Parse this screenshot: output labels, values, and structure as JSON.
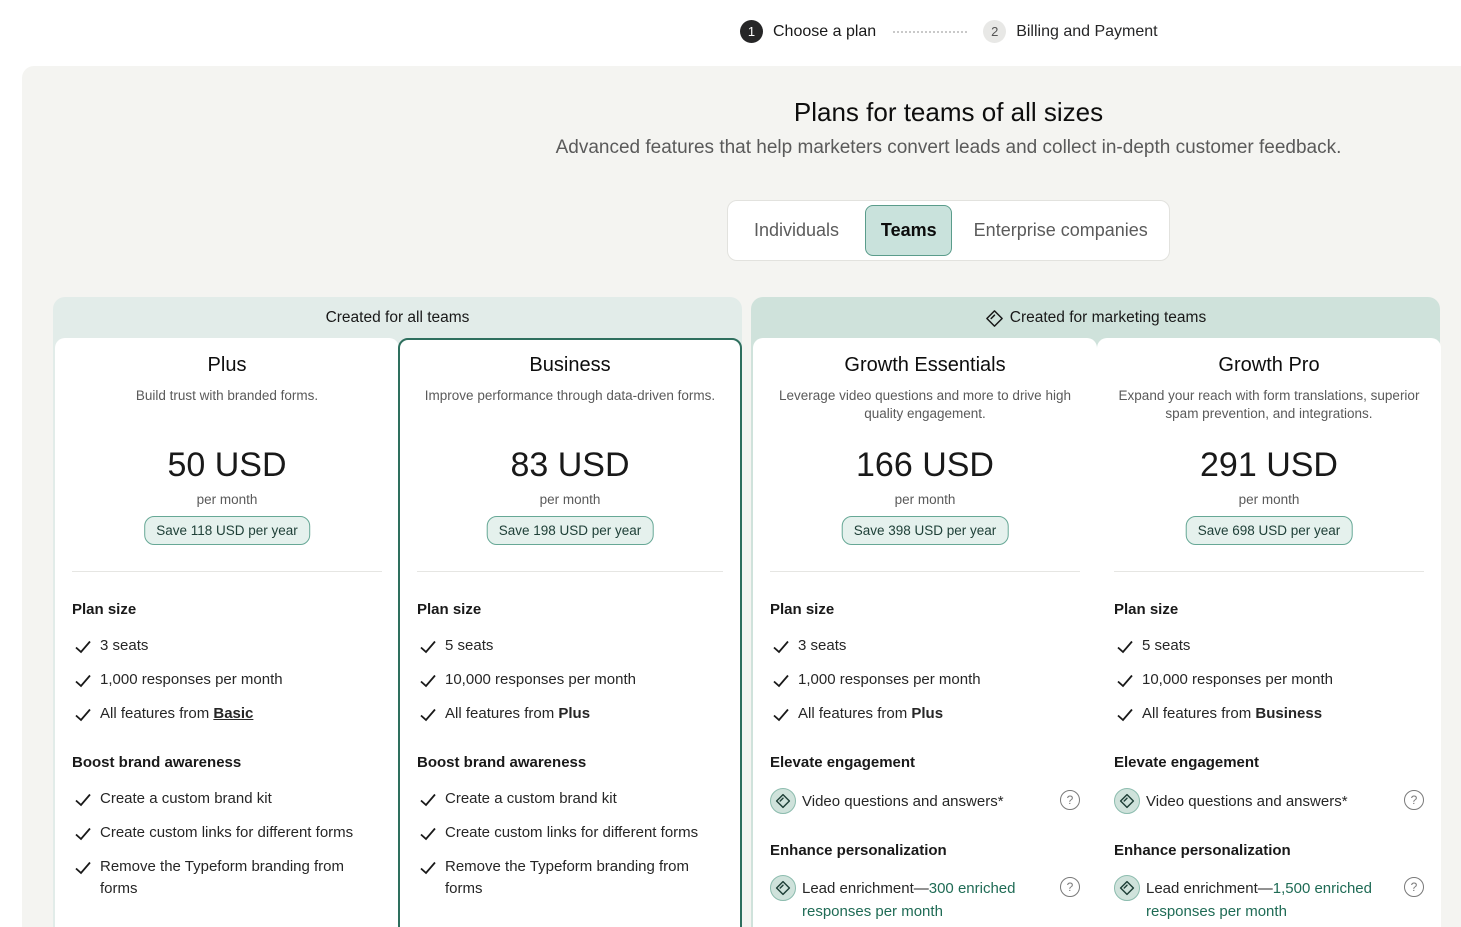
{
  "stepper": {
    "steps": [
      {
        "num": "1",
        "label": "Choose a plan"
      },
      {
        "num": "2",
        "label": "Billing and Payment"
      }
    ]
  },
  "header": {
    "title": "Plans for teams of all sizes",
    "subtitle": "Advanced features that help marketers convert leads and collect in-depth customer feedback."
  },
  "segmented": {
    "options": [
      "Individuals",
      "Teams",
      "Enterprise companies"
    ],
    "selected": "Teams"
  },
  "groups": {
    "all": "Created for all teams",
    "marketing": "Created for marketing teams"
  },
  "plans": [
    {
      "name": "Plus",
      "desc": "Build trust with branded forms.",
      "price": "50 USD",
      "per": "per month",
      "save": "Save 118 USD per year",
      "plan_size_title": "Plan size",
      "seats": "3 seats",
      "responses": "1,000 responses per month",
      "features_from_prefix": "All features from ",
      "features_from": "Basic",
      "section2_title": "Boost brand awareness",
      "f1": "Create a custom brand kit",
      "f2": "Create custom links for different forms",
      "f3": "Remove the Typeform branding from forms"
    },
    {
      "name": "Business",
      "desc": "Improve performance through data-driven forms.",
      "price": "83 USD",
      "per": "per month",
      "save": "Save 198 USD per year",
      "plan_size_title": "Plan size",
      "seats": "5 seats",
      "responses": "10,000 responses per month",
      "features_from_prefix": "All features from ",
      "features_from": "Plus",
      "section2_title": "Boost brand awareness",
      "f1": "Create a custom brand kit",
      "f2": "Create custom links for different forms",
      "f3": "Remove the Typeform branding from forms"
    },
    {
      "name": "Growth Essentials",
      "desc": "Leverage video questions and more to drive high quality engagement.",
      "price": "166 USD",
      "per": "per month",
      "save": "Save 398 USD per year",
      "plan_size_title": "Plan size",
      "seats": "3 seats",
      "responses": "1,000 responses per month",
      "features_from_prefix": "All features from ",
      "features_from": "Plus",
      "section2_title": "Elevate engagement",
      "video": "Video questions and answers*",
      "section3_title": "Enhance personalization",
      "lead_prefix": "Lead enrichment—",
      "lead_amount": "300 enriched responses per month"
    },
    {
      "name": "Growth Pro",
      "desc": "Expand your reach with form translations, superior spam prevention, and integrations.",
      "price": "291 USD",
      "per": "per month",
      "save": "Save 698 USD per year",
      "plan_size_title": "Plan size",
      "seats": "5 seats",
      "responses": "10,000 responses per month",
      "features_from_prefix": "All features from ",
      "features_from": "Business",
      "section2_title": "Elevate engagement",
      "video": "Video questions and answers*",
      "section3_title": "Enhance personalization",
      "lead_prefix": "Lead enrichment—",
      "lead_amount": "1,500 enriched responses per month"
    }
  ],
  "help_glyph": "?",
  "icons": {
    "check": "check-icon",
    "diamond": "diamond-icon",
    "help": "help-icon"
  },
  "colors": {
    "accent": "#2e6f5e",
    "teams_bg": "#c9e2dc",
    "save_bg": "#e5f1ed"
  }
}
